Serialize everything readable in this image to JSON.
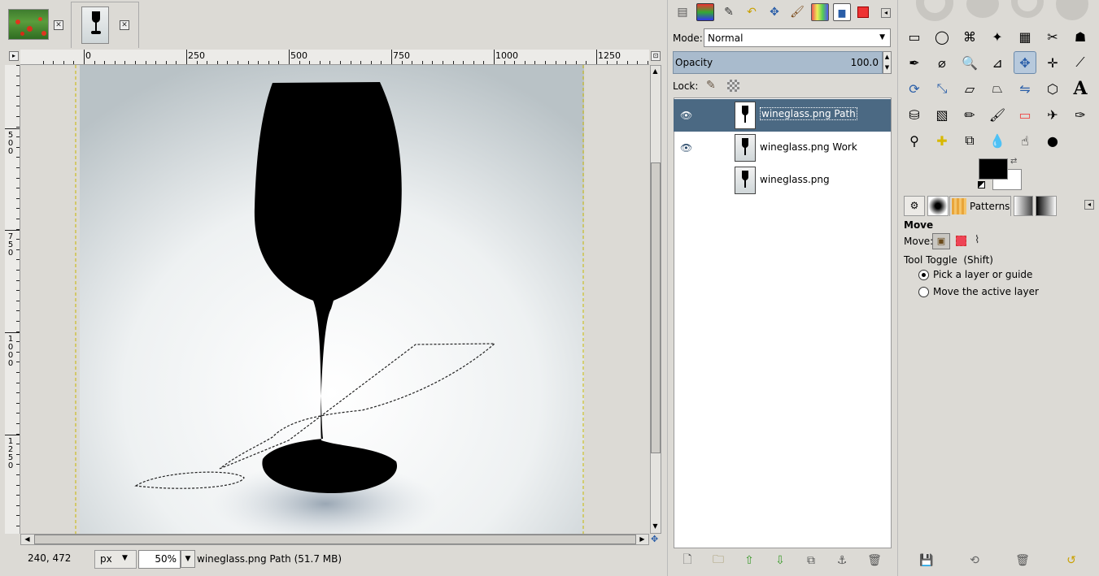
{
  "image_tabs": [
    {
      "name": "field-of-poppies-thumbnail"
    },
    {
      "name": "wineglass-thumbnail"
    }
  ],
  "ruler": {
    "h_labels": [
      "0",
      "250",
      "500",
      "750",
      "1000",
      "1250"
    ],
    "v_labels": [
      "500",
      "750",
      "1000",
      "1250"
    ]
  },
  "status": {
    "coords": "240, 472",
    "unit": "px",
    "zoom": "50%",
    "message": "wineglass.png Path (51.7 MB)"
  },
  "layers_panel": {
    "mode_label": "Mode:",
    "mode_value": "Normal",
    "opacity_label": "Opacity",
    "opacity_value": "100.0",
    "lock_label": "Lock:",
    "layers": [
      {
        "name": "wineglass.png Path",
        "visible": true,
        "selected": true
      },
      {
        "name": "wineglass.png Work",
        "visible": true,
        "selected": false
      },
      {
        "name": "wineglass.png",
        "visible": false,
        "selected": false
      }
    ]
  },
  "tool_options": {
    "tab_label": "Patterns",
    "title": "Move",
    "move_label": "Move:",
    "toggle_label": "Tool Toggle  (Shift)",
    "option1": "Pick a layer or guide",
    "option2": "Move the active layer",
    "selected_option": 1
  },
  "colors": {
    "accent": "#4b6983",
    "foreground": "#000000",
    "background": "#ffffff"
  }
}
